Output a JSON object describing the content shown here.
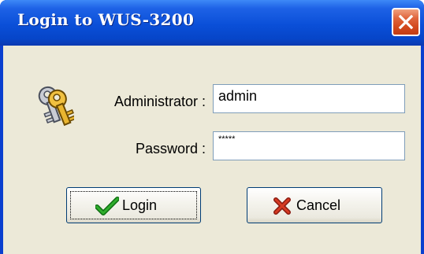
{
  "window": {
    "title": "Login to WUS-3200",
    "close_icon": "close-x-icon",
    "titlebar_color": "#0a4fd8",
    "close_color": "#d2481d"
  },
  "form": {
    "icon": "keys-icon",
    "admin_label": "Administrator :",
    "admin_value": "admin",
    "password_label": "Password :",
    "password_value": "*****"
  },
  "buttons": {
    "login_label": "Login",
    "login_icon": "checkmark-icon",
    "cancel_label": "Cancel",
    "cancel_icon": "x-cross-icon"
  }
}
